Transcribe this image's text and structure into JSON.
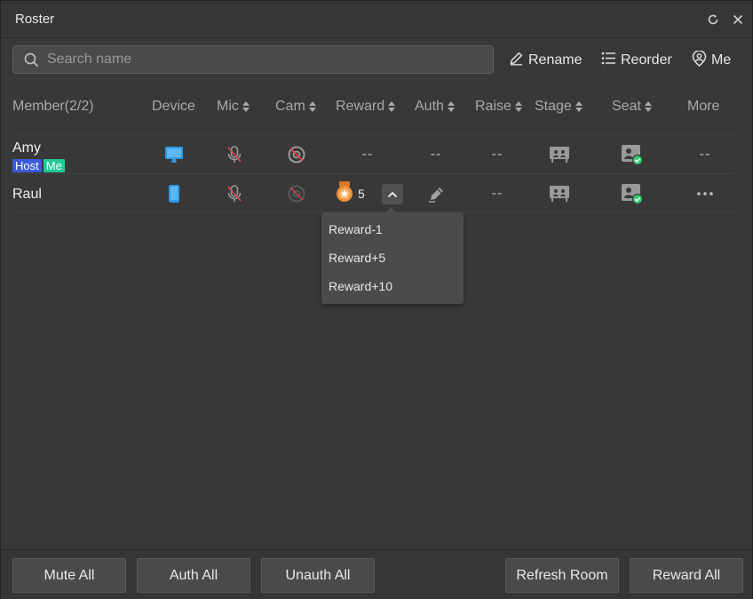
{
  "window": {
    "title": "Roster"
  },
  "search": {
    "placeholder": "Search name",
    "value": ""
  },
  "toolbar": {
    "rename": "Rename",
    "reorder": "Reorder",
    "me": "Me"
  },
  "columns": {
    "member": "Member(2/2)",
    "device": "Device",
    "mic": "Mic",
    "cam": "Cam",
    "reward": "Reward",
    "auth": "Auth",
    "raise": "Raise",
    "stage": "Stage",
    "seat": "Seat",
    "more": "More"
  },
  "members": [
    {
      "name": "Amy",
      "badges": {
        "host": "Host",
        "me": "Me"
      },
      "device": "desktop-icon",
      "mic": "mic-muted-icon",
      "cam": "camera-off-icon",
      "reward": "--",
      "auth": "--",
      "raise": "--",
      "stage": "stage-icon",
      "seat": "seat-check-icon",
      "more": "--"
    },
    {
      "name": "Raul",
      "device": "phone-icon",
      "mic": "mic-muted-icon",
      "cam": "camera-off-icon",
      "reward": "5",
      "auth": "pen-icon",
      "raise": "--",
      "stage": "stage-icon",
      "seat": "seat-check-icon",
      "more": "ellipsis-icon"
    }
  ],
  "reward_menu": [
    "Reward-1",
    "Reward+5",
    "Reward+10"
  ],
  "footer": {
    "mute_all": "Mute All",
    "auth_all": "Auth All",
    "unauth_all": "Unauth All",
    "refresh_room": "Refresh Room",
    "reward_all": "Reward All"
  },
  "colors": {
    "host_badge": "#3b5bdb",
    "me_badge": "#20c997",
    "device_blue": "#2f9ae8",
    "seat_check": "#2ecc71",
    "medal": "#f0913a"
  }
}
